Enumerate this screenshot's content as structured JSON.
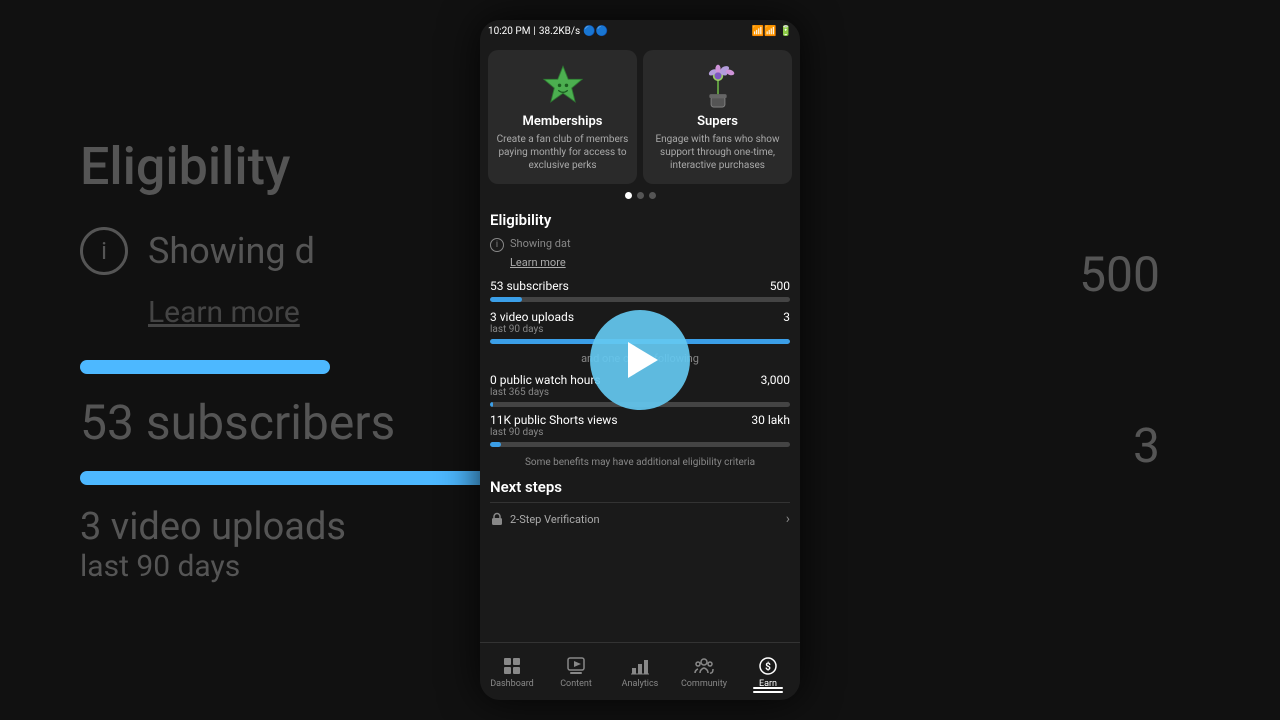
{
  "statusBar": {
    "time": "10:20 PM",
    "speed": "38.2KB/s",
    "battery": "21"
  },
  "cards": [
    {
      "id": "memberships",
      "title": "Memberships",
      "description": "Create a fan club of members paying monthly for access to exclusive perks"
    },
    {
      "id": "supers",
      "title": "Supers",
      "description": "Engage with fans who show support through one-time, interactive purchases"
    }
  ],
  "dots": [
    {
      "active": true
    },
    {
      "active": false
    },
    {
      "active": false
    }
  ],
  "eligibility": {
    "sectionTitle": "Eligibility",
    "showingDataText": "Showing dat",
    "learnMoreText": "Learn more",
    "metrics": [
      {
        "label": "53 subscribers",
        "sublabel": "",
        "value": "500",
        "progress": 10.6
      },
      {
        "label": "3 video uploads",
        "sublabel": "last 90 days",
        "value": "3",
        "progress": 100
      }
    ],
    "andOneOf": "and one of the following",
    "metrics2": [
      {
        "label": "0 public watch hours",
        "sublabel": "last 365 days",
        "value": "3,000",
        "progress": 1
      },
      {
        "label": "11K public Shorts views",
        "sublabel": "last 90 days",
        "value": "30 lakh",
        "progress": 3.7
      }
    ],
    "someBenefits": "Some benefits may have additional eligibility criteria"
  },
  "nextSteps": {
    "title": "Next steps",
    "items": [
      {
        "text": "2-Step Verification"
      }
    ]
  },
  "bottomNav": [
    {
      "id": "dashboard",
      "label": "Dashboard",
      "active": false
    },
    {
      "id": "content",
      "label": "Content",
      "active": false
    },
    {
      "id": "analytics",
      "label": "Analytics",
      "active": false
    },
    {
      "id": "community",
      "label": "Community",
      "active": false
    },
    {
      "id": "earn",
      "label": "Earn",
      "active": true
    }
  ],
  "background": {
    "eligibilityTitle": "Eligibility",
    "showingDText": "Showing d",
    "learnMoreText": "Learn more",
    "subscribersText": "53 subscribers",
    "uploadsText": "3 video uploads",
    "uploadsSub": "last 90 days",
    "rightVal1": "500",
    "rightVal2": "3"
  }
}
